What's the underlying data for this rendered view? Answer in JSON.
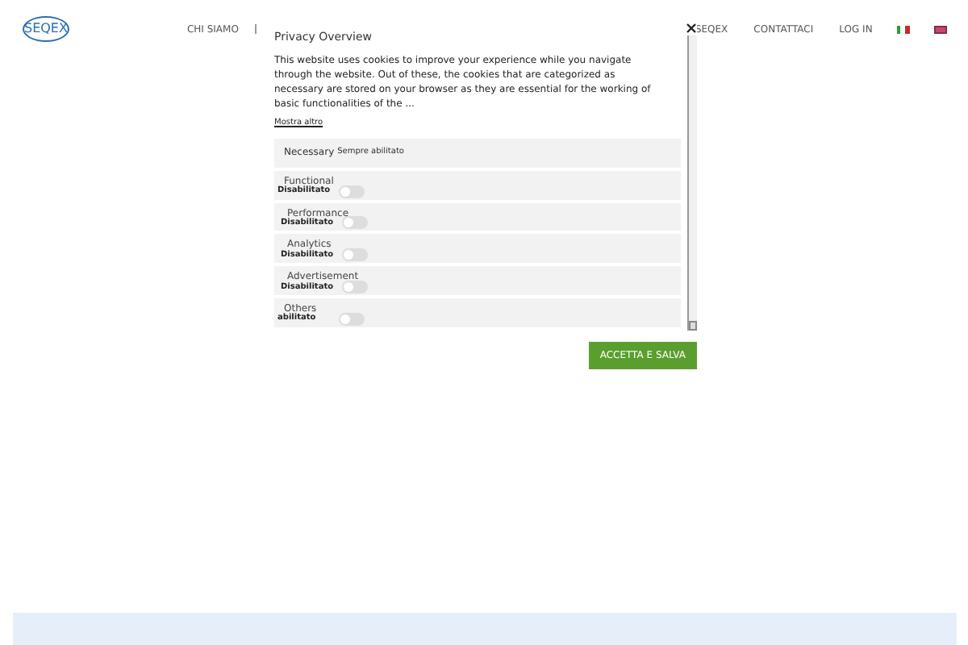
{
  "header": {
    "logo": "SEQEX",
    "nav": [
      {
        "label": "CHI SIAMO"
      },
      {
        "label": "SEQEX"
      },
      {
        "label": "CONTATTACI"
      },
      {
        "label": "LOG IN"
      }
    ],
    "languages": [
      {
        "kind": "it"
      },
      {
        "kind": "en"
      }
    ]
  },
  "privacy": {
    "title": "Privacy Overview",
    "text": "This website uses cookies to improve your experience while you navigate through the website. Out of these, the cookies that are categorized as necessary are stored on your browser as they are essential for the working of basic functionalities of the ...",
    "more": "Mostra altro",
    "categories": [
      {
        "kind": "always",
        "name": "Necessary",
        "status": "Sempre abilitato"
      },
      {
        "kind": "toggle",
        "name": "Functional",
        "status": "Disabilitato",
        "on": false
      },
      {
        "kind": "toggle",
        "name": "Performance",
        "status": "Disabilitato",
        "on": false
      },
      {
        "kind": "toggle",
        "name": "Analytics",
        "status": "Disabilitato",
        "on": false
      },
      {
        "kind": "toggle",
        "name": "Advertisement",
        "status": "Disabilitato",
        "on": false
      },
      {
        "kind": "toggle",
        "name": "Others",
        "status": "abilitato",
        "on": false
      }
    ],
    "button": "ACCETTA E SALVA"
  }
}
